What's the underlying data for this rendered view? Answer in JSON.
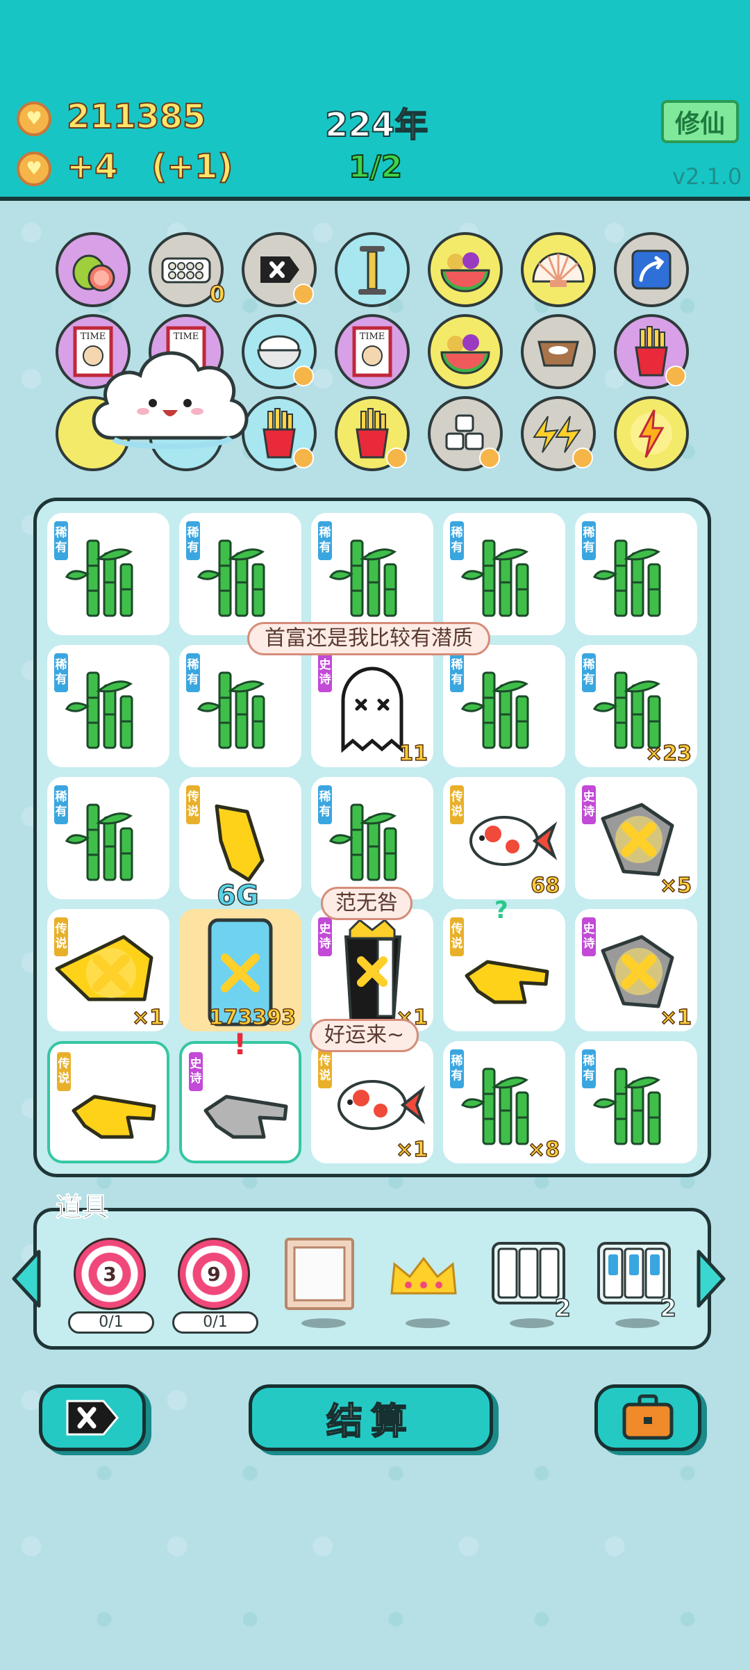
{
  "header": {
    "coins": "211385",
    "income": "+4",
    "income_bonus": "(+1)",
    "year": "224年",
    "round": "1/2",
    "cultivate_button": "修仙",
    "version": "v2.1.0"
  },
  "symbols": [
    {
      "name": "pomelo-icon",
      "count": ""
    },
    {
      "name": "egg-carton-icon",
      "count": "0"
    },
    {
      "name": "delete-tag-icon",
      "count": ""
    },
    {
      "name": "pump-icon",
      "count": ""
    },
    {
      "name": "fruit-salad-icon",
      "count": ""
    },
    {
      "name": "shell-icon",
      "count": ""
    },
    {
      "name": "arrow-card-icon",
      "count": ""
    },
    {
      "name": "time-magazine-icon",
      "count": ""
    },
    {
      "name": "time-magazine-icon",
      "count": ""
    },
    {
      "name": "rice-bowl-icon",
      "count": ""
    },
    {
      "name": "time-magazine-icon",
      "count": ""
    },
    {
      "name": "fruit-salad-icon",
      "count": ""
    },
    {
      "name": "pet-bowl-icon",
      "count": ""
    },
    {
      "name": "fries-icon",
      "count": ""
    },
    {
      "name": "shell-icon",
      "count": ""
    },
    {
      "name": "cloud-icon",
      "count": ""
    },
    {
      "name": "fries-icon",
      "count": ""
    },
    {
      "name": "fries-icon",
      "count": ""
    },
    {
      "name": "sugar-cubes-icon",
      "count": ""
    },
    {
      "name": "lightning-fish-icon",
      "count": ""
    },
    {
      "name": "lightning-icon",
      "count": ""
    }
  ],
  "rarity_labels": {
    "rare": "稀有",
    "epic": "史诗",
    "legend": "传说"
  },
  "board": [
    {
      "rarity": "rare",
      "item": "bamboo",
      "count": ""
    },
    {
      "rarity": "rare",
      "item": "bamboo",
      "count": ""
    },
    {
      "rarity": "rare",
      "item": "bamboo",
      "count": ""
    },
    {
      "rarity": "rare",
      "item": "bamboo",
      "count": ""
    },
    {
      "rarity": "rare",
      "item": "bamboo",
      "count": ""
    },
    {
      "rarity": "rare",
      "item": "bamboo",
      "count": ""
    },
    {
      "rarity": "rare",
      "item": "bamboo",
      "count": ""
    },
    {
      "rarity": "epic",
      "item": "ghost",
      "count": "11"
    },
    {
      "rarity": "rare",
      "item": "bamboo",
      "count": ""
    },
    {
      "rarity": "rare",
      "item": "bamboo",
      "count": "×23"
    },
    {
      "rarity": "rare",
      "item": "bamboo",
      "count": ""
    },
    {
      "rarity": "legend",
      "item": "pointer",
      "count": ""
    },
    {
      "rarity": "rare",
      "item": "bamboo",
      "count": ""
    },
    {
      "rarity": "legend",
      "item": "koi",
      "count": "68"
    },
    {
      "rarity": "epic",
      "item": "rock-hand",
      "count": "×5"
    },
    {
      "rarity": "legend",
      "item": "rock-hand-gold",
      "count": "×1"
    },
    {
      "rarity": "",
      "item": "phone",
      "count": "173393"
    },
    {
      "rarity": "epic",
      "item": "wuchang",
      "count": "×1"
    },
    {
      "rarity": "legend",
      "item": "point-hand",
      "count": ""
    },
    {
      "rarity": "epic",
      "item": "rock-hand",
      "count": "×1"
    },
    {
      "rarity": "legend",
      "item": "point-hand",
      "count": ""
    },
    {
      "rarity": "epic",
      "item": "point-hand-gray",
      "count": ""
    },
    {
      "rarity": "legend",
      "item": "koi",
      "count": "×1"
    },
    {
      "rarity": "rare",
      "item": "bamboo",
      "count": "×8"
    },
    {
      "rarity": "rare",
      "item": "bamboo",
      "count": ""
    }
  ],
  "bubbles": {
    "ghost": "首富还是我比较有潜质",
    "wuchang": "范无咎",
    "koi": "好运来~"
  },
  "floating": {
    "phone_label": "6G",
    "question": "?",
    "exclaim": "!"
  },
  "items_title": "道具",
  "items": [
    {
      "name": "target-icon",
      "value": "3",
      "usage": "0/1"
    },
    {
      "name": "target-icon",
      "value": "9",
      "usage": "0/1"
    },
    {
      "name": "frame-icon",
      "value": "",
      "usage": ""
    },
    {
      "name": "crown-icon",
      "value": "",
      "usage": ""
    },
    {
      "name": "triple-card-icon",
      "value": "2",
      "usage": ""
    },
    {
      "name": "rare-triple-card-icon",
      "value": "2",
      "usage": ""
    }
  ],
  "buttons": {
    "settle": "结算"
  },
  "colors": {
    "accent": "#17c6c4",
    "background": "#b6dfe6",
    "gold": "#ffe46a",
    "green": "#3ed24a"
  }
}
